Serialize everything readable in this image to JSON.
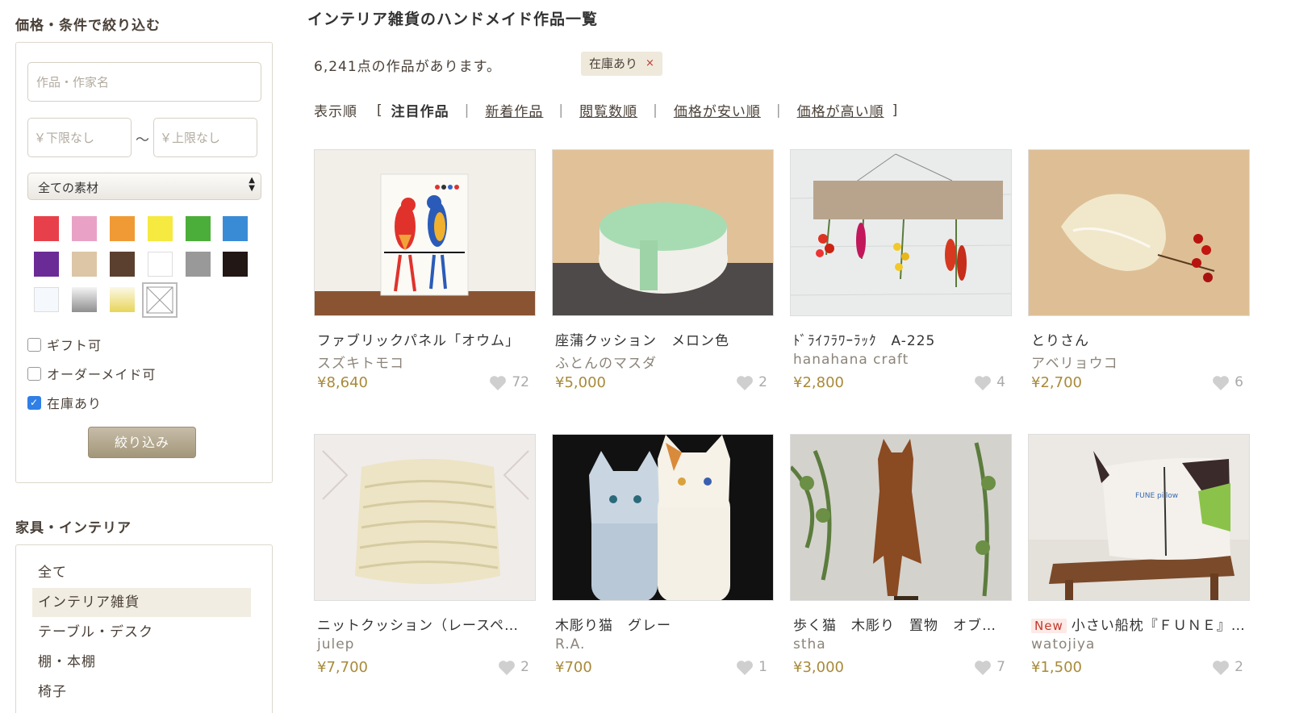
{
  "sidebar": {
    "filter_heading": "価格・条件で絞り込む",
    "search_placeholder": "作品・作家名",
    "price_min_placeholder": "￥下限なし",
    "price_max_placeholder": "￥上限なし",
    "price_separator": "〜",
    "material_select": "全ての素材",
    "colors": [
      "#e8404a",
      "#e9a2c6",
      "#f09a35",
      "#f6e93f",
      "#4cae3a",
      "#3a8bd6",
      "#6b2b96",
      "#dcc6a6",
      "#5b4030",
      "#ffffff",
      "#999999",
      "#221714",
      "#f5f8fc",
      "gradient-silver",
      "gradient-gold",
      "none"
    ],
    "checkboxes": [
      {
        "label": "ギフト可",
        "checked": false
      },
      {
        "label": "オーダーメイド可",
        "checked": false
      },
      {
        "label": "在庫あり",
        "checked": true
      }
    ],
    "submit_label": "絞り込み",
    "category_heading": "家具・インテリア",
    "categories": [
      {
        "label": "全て",
        "active": false
      },
      {
        "label": "インテリア雑貨",
        "active": true
      },
      {
        "label": "テーブル・デスク",
        "active": false
      },
      {
        "label": "棚・本棚",
        "active": false
      },
      {
        "label": "椅子",
        "active": false
      }
    ]
  },
  "main": {
    "title": "インテリア雑貨のハンドメイド作品一覧",
    "count_text": "6,241点の作品があります。",
    "tag_label": "在庫あり",
    "tag_close": "×",
    "sort": {
      "label": "表示順",
      "open": "[",
      "close": "]",
      "separator": "|",
      "current": "注目作品",
      "options": [
        "新着作品",
        "閲覧数順",
        "価格が安い順",
        "価格が高い順"
      ]
    },
    "products": [
      {
        "title": "ファブリックパネル「オウム」",
        "artist": "スズキトモコ",
        "price": "¥8,640",
        "favs": "72",
        "is_new": false
      },
      {
        "title": "座蒲クッション　メロン色",
        "artist": "ふとんのマスダ",
        "price": "¥5,000",
        "favs": "2",
        "is_new": false
      },
      {
        "title": "ﾄﾞﾗｲﾌﾗﾜｰﾗｯｸ　A-225",
        "artist": "hanahana craft",
        "price": "¥2,800",
        "favs": "4",
        "is_new": false
      },
      {
        "title": "とりさん",
        "artist": "アベリョウコ",
        "price": "¥2,700",
        "favs": "6",
        "is_new": false
      },
      {
        "title": "ニットクッション（レースペ…",
        "artist": "julep",
        "price": "¥7,700",
        "favs": "2",
        "is_new": false
      },
      {
        "title": "木彫り猫　グレー",
        "artist": "R.A.",
        "price": "¥700",
        "favs": "1",
        "is_new": false
      },
      {
        "title": "歩く猫　木彫り　置物　オブ…",
        "artist": "stha",
        "price": "¥3,000",
        "favs": "7",
        "is_new": false
      },
      {
        "title": "小さい船枕『ＦＵＮＥ』…",
        "artist": "watojiya",
        "price": "¥1,500",
        "favs": "2",
        "is_new": true,
        "badge": "New"
      }
    ],
    "pillow_print": "FUNE pillow"
  }
}
